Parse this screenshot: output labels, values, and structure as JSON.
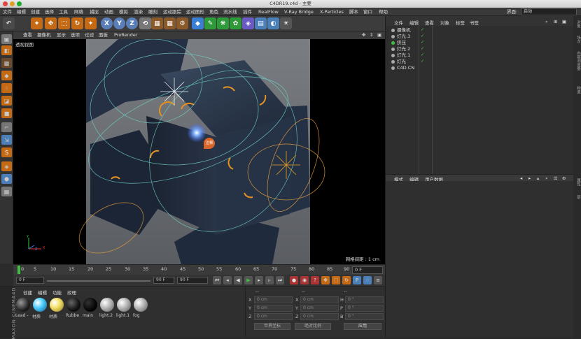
{
  "window": {
    "title": "C4DR19.c4d - 主要"
  },
  "menubar": {
    "items": [
      "文件",
      "编辑",
      "创建",
      "选择",
      "工具",
      "网格",
      "捕捉",
      "动画",
      "模拟",
      "渲染",
      "雕刻",
      "运动跟踪",
      "运动图形",
      "角色",
      "流水线",
      "插件",
      "RealFlow",
      "V-Ray Bridge",
      "X-Particles",
      "脚本",
      "窗口",
      "帮助"
    ],
    "layout_label": "界面:",
    "layout_value": "启动"
  },
  "toolbar": {
    "undo": "↶",
    "axis_x": "X",
    "axis_y": "Y",
    "axis_z": "Z"
  },
  "viewport": {
    "menu": [
      "查看",
      "摄像机",
      "显示",
      "选项",
      "过滤",
      "面板",
      "ProRender"
    ],
    "title": "透视视图",
    "annotation": "注释",
    "grid_info": "网格间距 : 1 cm",
    "axis_x": "X",
    "axis_y": "Y",
    "axis_z": "Z"
  },
  "timeline": {
    "ticks": [
      "0",
      "5",
      "10",
      "15",
      "20",
      "25",
      "30",
      "35",
      "40",
      "45",
      "50",
      "55",
      "60",
      "65",
      "70",
      "75",
      "80",
      "85",
      "90"
    ],
    "current_frame": "0 F"
  },
  "transport": {
    "start": "0 F",
    "end_field": "90 F",
    "end2": "90 F"
  },
  "materials": {
    "brand": "MAXON CINEMA4D",
    "menu": [
      "创建",
      "编辑",
      "功能",
      "纹理"
    ],
    "items": [
      {
        "label": "Lead -"
      },
      {
        "label": "材质"
      },
      {
        "label": "材质"
      },
      {
        "label": "Rubbe"
      },
      {
        "label": "main"
      },
      {
        "label": "light.2"
      },
      {
        "label": "light.1"
      },
      {
        "label": "fog"
      }
    ]
  },
  "coordinates": {
    "header": [
      "--",
      "--",
      "--"
    ],
    "rows": [
      {
        "a": "X",
        "av": "0 cm",
        "b": "X",
        "bv": "0 cm",
        "c": "H",
        "cv": "0 °"
      },
      {
        "a": "Y",
        "av": "0 cm",
        "b": "Y",
        "bv": "0 cm",
        "c": "P",
        "cv": "0 °"
      },
      {
        "a": "Z",
        "av": "0 cm",
        "b": "Z",
        "bv": "0 cm",
        "c": "B",
        "cv": "0 °"
      }
    ],
    "mode1": "世界坐标",
    "mode2": "绝对比例",
    "apply": "应用"
  },
  "objects": {
    "menu": [
      "文件",
      "编辑",
      "查看",
      "对象",
      "标签",
      "书签"
    ],
    "items": [
      {
        "name": "摄像机",
        "color": "#aaaaaa",
        "check": "✓"
      },
      {
        "name": "灯光.3",
        "color": "#aaaaaa",
        "check": "✓"
      },
      {
        "name": "挤压",
        "color": "#3fbf3f",
        "check": "✓"
      },
      {
        "name": "灯光.2",
        "color": "#aaaaaa",
        "check": "✓"
      },
      {
        "name": "灯光.1",
        "color": "#aaaaaa",
        "check": "✓"
      },
      {
        "name": "灯光",
        "color": "#aaaaaa",
        "check": "✓"
      },
      {
        "name": "C4D.CN",
        "color": "#aaaaaa",
        "check": ""
      }
    ]
  },
  "attributes": {
    "menu": [
      "模式",
      "编辑",
      "用户数据"
    ]
  },
  "sidetabs": [
    "对象",
    "场次",
    "内容浏览器",
    "构造",
    "属性",
    "层"
  ]
}
